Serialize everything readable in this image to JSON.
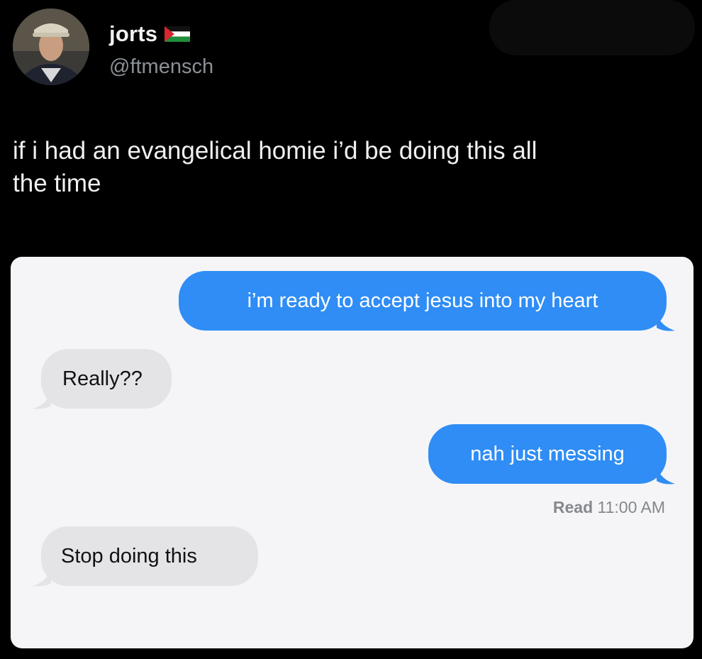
{
  "user": {
    "display_name": "jorts",
    "handle": "@ftmensch",
    "flag_icon": "palestine-flag-icon"
  },
  "tweet": {
    "text": "if i had an evangelical homie i’d be doing this all\nthe time"
  },
  "conversation": {
    "messages": [
      {
        "from": "me",
        "text": "i’m ready to accept jesus into my heart"
      },
      {
        "from": "them",
        "text": "Really??"
      },
      {
        "from": "me",
        "text": "nah just messing"
      },
      {
        "from": "them",
        "text": "Stop doing this"
      }
    ],
    "read_receipt": {
      "label": "Read",
      "time": "11:00 AM"
    }
  },
  "colors": {
    "background": "#000000",
    "sent_bubble": "#2f8df5",
    "received_bubble": "#e4e4e7",
    "conversation_panel": "#f5f5f7"
  }
}
